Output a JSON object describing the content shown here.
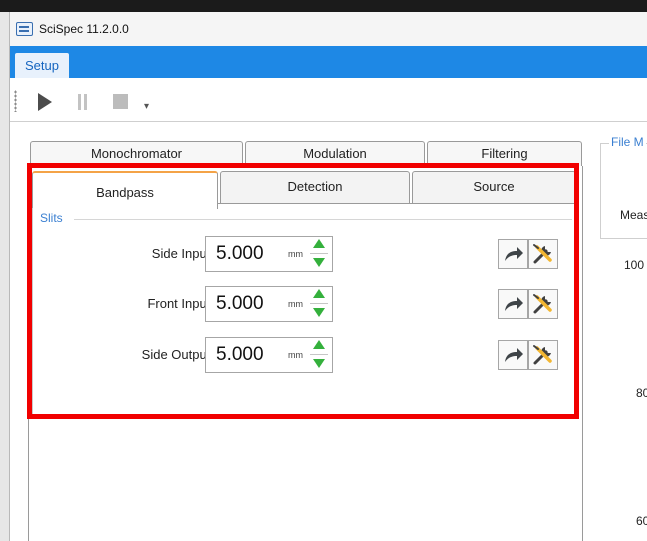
{
  "window": {
    "title": "SciSpec 11.2.0.0"
  },
  "ribbon": {
    "active_tab": "Setup"
  },
  "toolbar": {
    "more_glyph": "▾"
  },
  "outer_tabs": [
    "Monochromator",
    "Modulation",
    "Filtering"
  ],
  "inner_tabs": [
    "Bandpass",
    "Detection",
    "Source"
  ],
  "slits": {
    "group_label": "Slits",
    "rows": [
      {
        "label": "Side Input Slit",
        "value": "5.000",
        "unit": "mm"
      },
      {
        "label": "Front Input Slit",
        "value": "5.000",
        "unit": "mm"
      },
      {
        "label": "Side Output Slit",
        "value": "5.000",
        "unit": "mm"
      }
    ]
  },
  "right_panel": {
    "title": "File M",
    "label": "Meas",
    "numbers": [
      "100",
      "80",
      "60"
    ]
  },
  "colors": {
    "ribbon": "#1e88e5",
    "highlight_box": "#f10000",
    "spinner": "#34b03c",
    "active_tab_accent": "#f4a347",
    "group_label": "#3a7fd1"
  }
}
